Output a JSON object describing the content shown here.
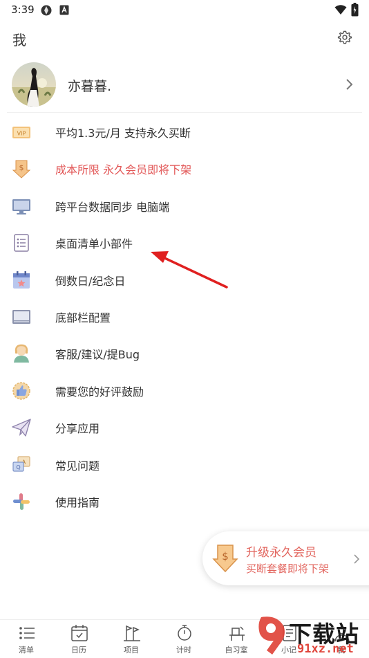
{
  "status_bar": {
    "time": "3:39"
  },
  "header": {
    "title": "我"
  },
  "profile": {
    "username": "亦暮暮."
  },
  "menu": [
    {
      "label": "平均1.3元/月 支持永久买断",
      "icon": "vip-icon",
      "color": "#333333"
    },
    {
      "label": "成本所限 永久会员即将下架",
      "icon": "dollar-down-icon",
      "color": "#e25656"
    },
    {
      "label": "跨平台数据同步 电脑端",
      "icon": "monitor-icon",
      "color": "#333333"
    },
    {
      "label": "桌面清单小部件",
      "icon": "checklist-icon",
      "color": "#333333"
    },
    {
      "label": "倒数日/纪念日",
      "icon": "calendar-icon",
      "color": "#333333"
    },
    {
      "label": "底部栏配置",
      "icon": "bottom-bar-icon",
      "color": "#333333"
    },
    {
      "label": "客服/建议/提Bug",
      "icon": "support-icon",
      "color": "#333333"
    },
    {
      "label": "需要您的好评鼓励",
      "icon": "thumbs-up-icon",
      "color": "#333333"
    },
    {
      "label": "分享应用",
      "icon": "paper-plane-icon",
      "color": "#333333"
    },
    {
      "label": "常见问题",
      "icon": "faq-icon",
      "color": "#333333"
    },
    {
      "label": "使用指南",
      "icon": "guide-icon",
      "color": "#333333"
    }
  ],
  "promo": {
    "title": "升级永久会员",
    "subtitle": "买断套餐即将下架",
    "color": "#e2655e"
  },
  "tabs": [
    {
      "label": "清单",
      "icon": "list-icon"
    },
    {
      "label": "日历",
      "icon": "calendar-tab-icon"
    },
    {
      "label": "项目",
      "icon": "project-icon"
    },
    {
      "label": "计时",
      "icon": "timer-icon"
    },
    {
      "label": "自习室",
      "icon": "study-room-icon"
    },
    {
      "label": "小记",
      "icon": "note-icon"
    },
    {
      "label": "我",
      "icon": "me-icon"
    }
  ],
  "watermark": {
    "brand": "下载站",
    "domain": "91xz.net"
  }
}
